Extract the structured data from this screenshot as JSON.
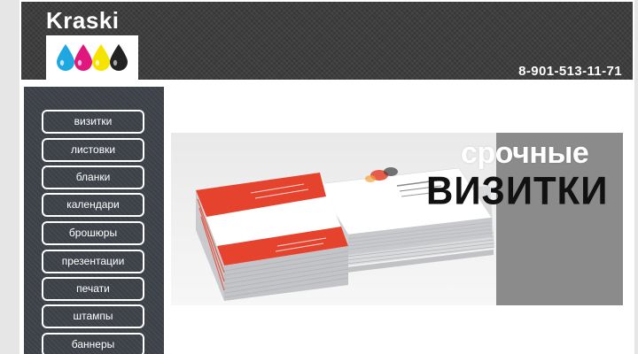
{
  "header": {
    "logo_text": "Kraski",
    "phone": "8-901-513-11-71"
  },
  "colors": {
    "header_bg": "#3a3a3a",
    "sidebar_bg": "#3e4349",
    "ink_cyan": "#1ea7e1",
    "ink_magenta": "#e0177c",
    "ink_yellow": "#f5e400",
    "ink_black": "#222222",
    "card_red": "#e5432d",
    "banner_gray": "#8b8b8b"
  },
  "icons": {
    "logo_drops": [
      "cyan-drop-icon",
      "magenta-drop-icon",
      "yellow-drop-icon",
      "black-drop-icon"
    ]
  },
  "sidebar": {
    "items": [
      {
        "label": "визитки"
      },
      {
        "label": "листовки"
      },
      {
        "label": "бланки"
      },
      {
        "label": "календари"
      },
      {
        "label": "брошюры"
      },
      {
        "label": "презентации"
      },
      {
        "label": "печати"
      },
      {
        "label": "штампы"
      },
      {
        "label": "баннеры"
      }
    ]
  },
  "banner": {
    "headline_1": "срочные",
    "headline_2": "ВИЗИТКИ"
  }
}
